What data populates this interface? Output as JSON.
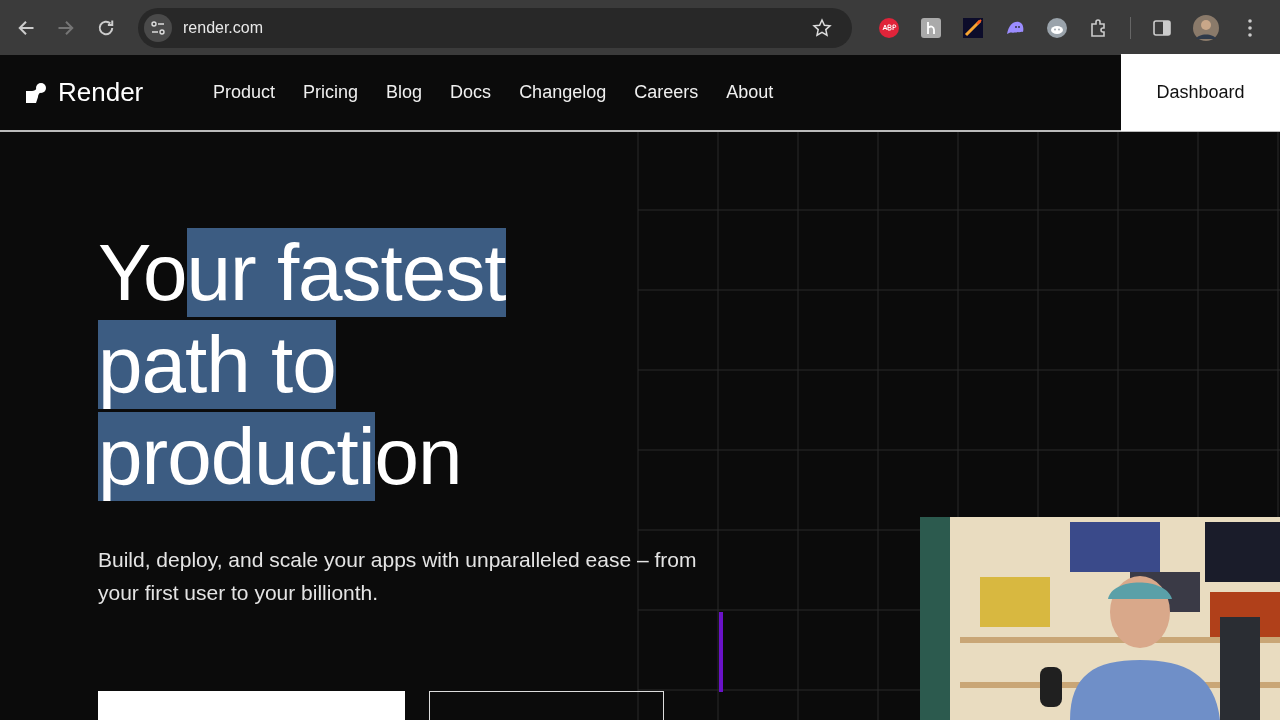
{
  "browser": {
    "url": "render.com",
    "back_disabled": false,
    "forward_disabled": true,
    "bookmarked": false
  },
  "site": {
    "logo": "Render",
    "nav": [
      "Product",
      "Pricing",
      "Blog",
      "Docs",
      "Changelog",
      "Careers",
      "About"
    ],
    "dashboard": "Dashboard"
  },
  "hero": {
    "headline": [
      {
        "text": "Yo",
        "highlighted": false
      },
      {
        "text": "ur fastest path to producti",
        "highlighted": true
      },
      {
        "text": "on",
        "highlighted": false
      }
    ],
    "subtitle": "Build, deploy, and scale your apps with unparalleled ease – from your first user to your billionth."
  }
}
